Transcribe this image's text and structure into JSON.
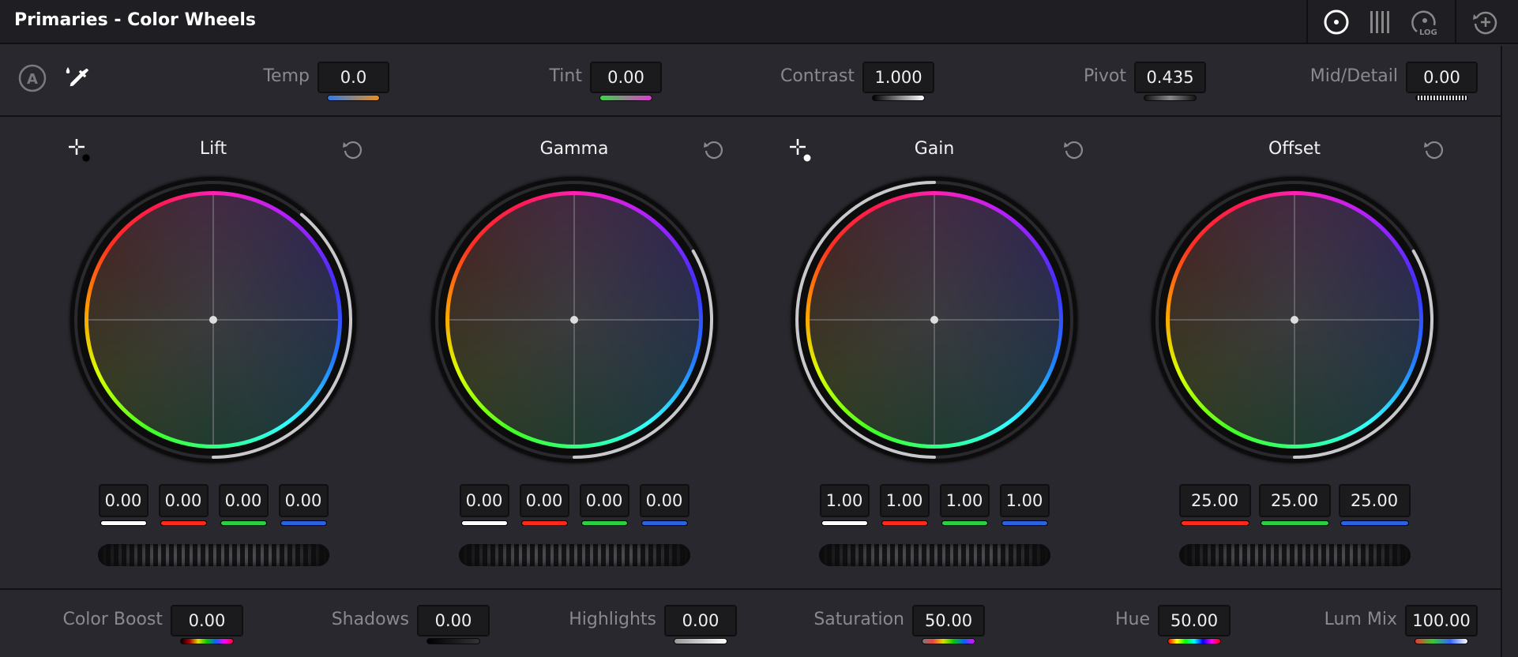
{
  "title": "Primaries - Color Wheels",
  "toolbar": {
    "icons": [
      "color-wheels-icon",
      "bars-icon",
      "log-wheels-icon",
      "reset-all-icon"
    ],
    "log_label": "LOG"
  },
  "params": [
    {
      "label": "Temp",
      "value": "0.0",
      "indicator": "linear-gradient(90deg,#2f7bea,#e8901a)"
    },
    {
      "label": "Tint",
      "value": "0.00",
      "indicator": "linear-gradient(90deg,#3ed24a,#e03ad0)"
    },
    {
      "label": "Contrast",
      "value": "1.000",
      "indicator": "linear-gradient(90deg,#000,#fff)"
    },
    {
      "label": "Pivot",
      "value": "0.435",
      "indicator": "linear-gradient(90deg,#111,#888,#111)"
    },
    {
      "label": "Mid/Detail",
      "value": "0.00",
      "indicator": "repeating-linear-gradient(90deg,#111 0 2px,#ddd 2px 4px)"
    }
  ],
  "auto_label": "A",
  "wheels": [
    {
      "name": "Lift",
      "values": [
        "0.00",
        "0.00",
        "0.00",
        "0.00"
      ],
      "picker": true
    },
    {
      "name": "Gamma",
      "values": [
        "0.00",
        "0.00",
        "0.00",
        "0.00"
      ],
      "picker": false
    },
    {
      "name": "Gain",
      "values": [
        "1.00",
        "1.00",
        "1.00",
        "1.00"
      ],
      "picker": true
    },
    {
      "name": "Offset",
      "values": [
        "25.00",
        "25.00",
        "25.00"
      ],
      "picker": false
    }
  ],
  "channel_colors": {
    "y": "#ffffff",
    "r": "#ff2a1a",
    "g": "#2ad040",
    "b": "#2a62e0"
  },
  "bottom": [
    {
      "label": "Color Boost",
      "value": "0.00",
      "indicator": "linear-gradient(90deg,#000,#a00,#dd0,#0c0,#06f,#f0f,#f03)"
    },
    {
      "label": "Shadows",
      "value": "0.00",
      "indicator": "linear-gradient(90deg,#000,#333)"
    },
    {
      "label": "Highlights",
      "value": "0.00",
      "indicator": "linear-gradient(90deg,#999,#fff)"
    },
    {
      "label": "Saturation",
      "value": "50.00",
      "indicator": "linear-gradient(90deg,#777,#e44,#dd0,#0c0,#06f,#f0f)"
    },
    {
      "label": "Hue",
      "value": "50.00",
      "indicator": "linear-gradient(90deg,#f00,#ff0,#0f0,#0ff,#00f,#f0f,#f00)"
    },
    {
      "label": "Lum Mix",
      "value": "100.00",
      "indicator": "linear-gradient(90deg,#e33,#3c3,#36f,#fff)"
    }
  ]
}
